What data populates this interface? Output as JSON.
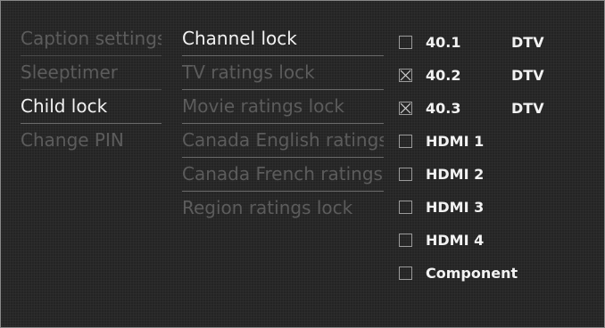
{
  "menu": {
    "items": [
      {
        "label": "Caption settings",
        "state": "dim"
      },
      {
        "label": "Sleeptimer",
        "state": "dim"
      },
      {
        "label": "Child lock",
        "state": "on"
      },
      {
        "label": "Change PIN",
        "state": "dim"
      }
    ]
  },
  "submenu": {
    "items": [
      {
        "label": "Channel lock",
        "state": "on"
      },
      {
        "label": "TV ratings lock",
        "state": "dim"
      },
      {
        "label": "Movie ratings lock",
        "state": "dim"
      },
      {
        "label": "Canada English ratings lo",
        "state": "dim"
      },
      {
        "label": "Canada French ratings lo",
        "state": "dim"
      },
      {
        "label": "Region ratings lock",
        "state": "dim"
      }
    ]
  },
  "channels": [
    {
      "name": "40.1",
      "type": "DTV",
      "locked": false
    },
    {
      "name": "40.2",
      "type": "DTV",
      "locked": true
    },
    {
      "name": "40.3",
      "type": "DTV",
      "locked": true
    },
    {
      "name": "HDMI 1",
      "type": "",
      "locked": false
    },
    {
      "name": "HDMI 2",
      "type": "",
      "locked": false
    },
    {
      "name": "HDMI 3",
      "type": "",
      "locked": false
    },
    {
      "name": "HDMI 4",
      "type": "",
      "locked": false
    },
    {
      "name": "Component",
      "type": "",
      "locked": false
    }
  ]
}
